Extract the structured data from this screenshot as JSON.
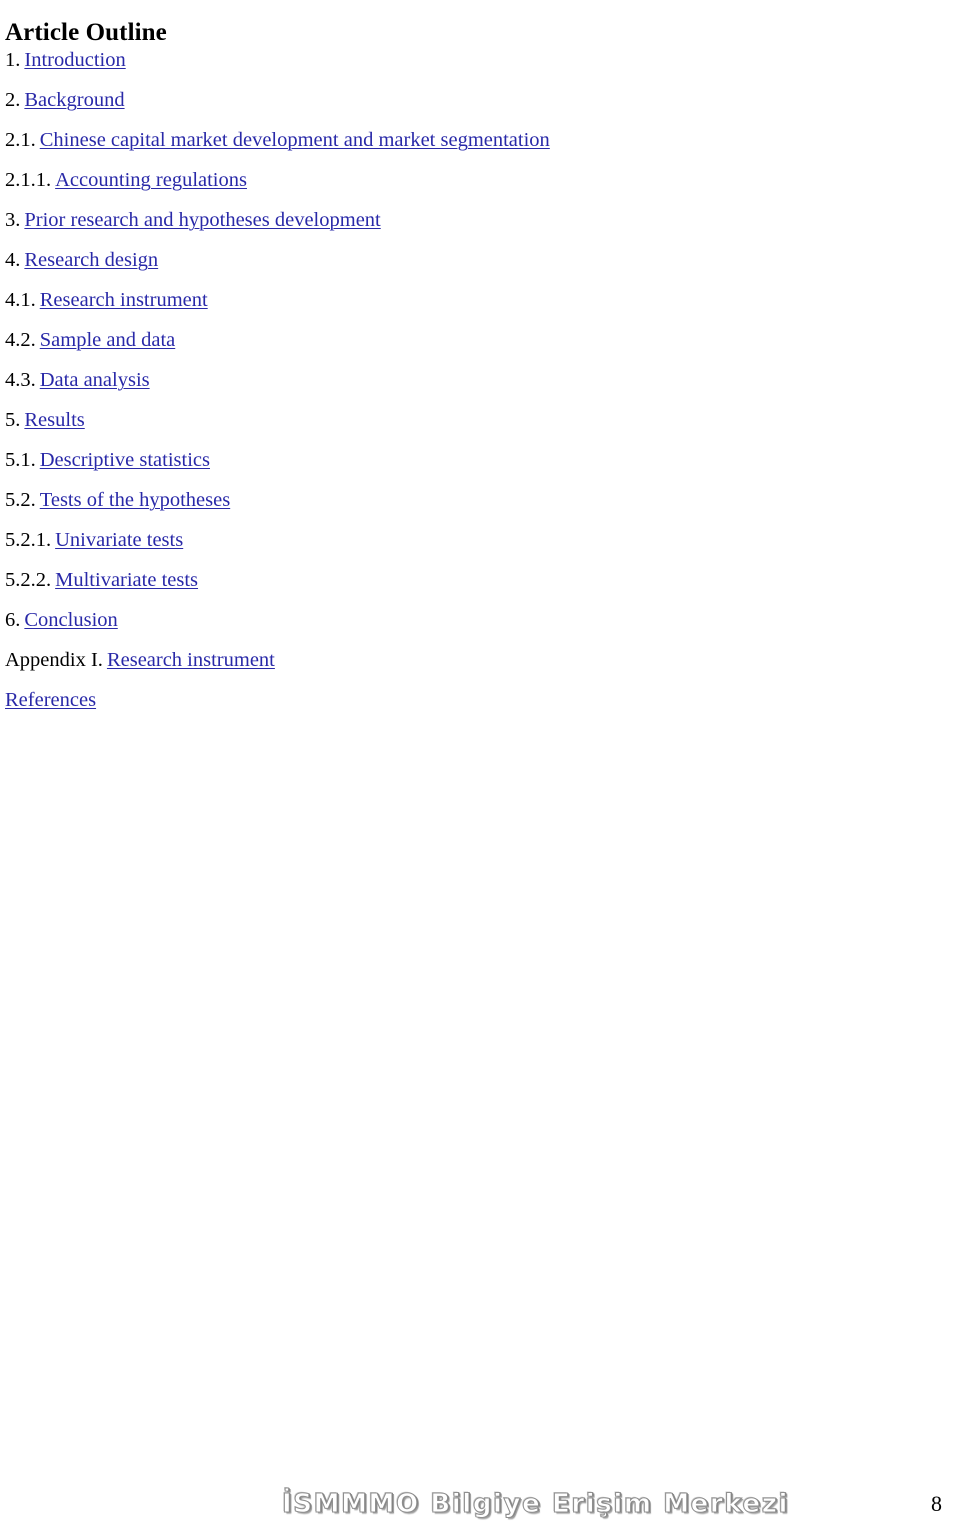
{
  "document": {
    "title": "Article Outline",
    "link_color": "#2929a8",
    "text_color": "#000000",
    "background_color": "#ffffff"
  },
  "outline": {
    "items": [
      {
        "prefix": "1.",
        "label": "Introduction"
      },
      {
        "prefix": "2.",
        "label": "Background"
      },
      {
        "prefix": "2.1.",
        "label": "Chinese capital market development and market segmentation"
      },
      {
        "prefix": "2.1.1.",
        "label": "Accounting regulations"
      },
      {
        "prefix": "3.",
        "label": "Prior research and hypotheses development"
      },
      {
        "prefix": "4.",
        "label": "Research design"
      },
      {
        "prefix": "4.1.",
        "label": "Research instrument"
      },
      {
        "prefix": "4.2.",
        "label": "Sample and data"
      },
      {
        "prefix": "4.3.",
        "label": "Data analysis"
      },
      {
        "prefix": "5.",
        "label": "Results"
      },
      {
        "prefix": "5.1.",
        "label": "Descriptive statistics"
      },
      {
        "prefix": "5.2.",
        "label": "Tests of the hypotheses"
      },
      {
        "prefix": "5.2.1.",
        "label": "Univariate tests"
      },
      {
        "prefix": "5.2.2.",
        "label": "Multivariate tests"
      },
      {
        "prefix": "6.",
        "label": "Conclusion"
      },
      {
        "prefix": "Appendix I.",
        "label": "Research instrument"
      },
      {
        "prefix": "",
        "label": "References"
      }
    ]
  },
  "footer": {
    "watermark": "İSMMMO Bilgiye Erişim Merkezi",
    "page_number": "8"
  }
}
